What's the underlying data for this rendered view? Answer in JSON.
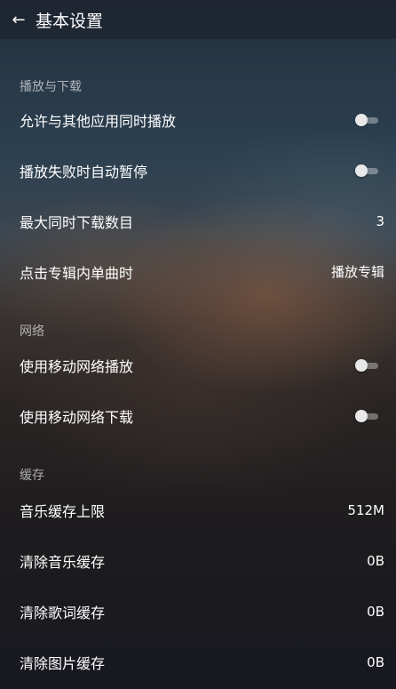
{
  "header": {
    "back_icon": "arrow-left-icon",
    "title": "基本设置"
  },
  "sections": [
    {
      "title": "播放与下载",
      "rows": [
        {
          "label": "允许与其他应用同时播放",
          "type": "toggle",
          "state": "off"
        },
        {
          "label": "播放失败时自动暂停",
          "type": "toggle",
          "state": "off"
        },
        {
          "label": "最大同时下载数目",
          "type": "value",
          "value": "3"
        },
        {
          "label": "点击专辑内单曲时",
          "type": "value",
          "value": "播放专辑"
        }
      ]
    },
    {
      "title": "网络",
      "rows": [
        {
          "label": "使用移动网络播放",
          "type": "toggle",
          "state": "off"
        },
        {
          "label": "使用移动网络下载",
          "type": "toggle",
          "state": "off"
        }
      ]
    },
    {
      "title": "缓存",
      "rows": [
        {
          "label": "音乐缓存上限",
          "type": "value",
          "value": "512M"
        },
        {
          "label": "清除音乐缓存",
          "type": "value",
          "value": "0B"
        },
        {
          "label": "清除歌词缓存",
          "type": "value",
          "value": "0B"
        },
        {
          "label": "清除图片缓存",
          "type": "value",
          "value": "0B"
        }
      ]
    }
  ],
  "colors": {
    "text": "#ffffff",
    "section_header": "#a0a3a8",
    "toggle_thumb": "#e8e8e8"
  }
}
